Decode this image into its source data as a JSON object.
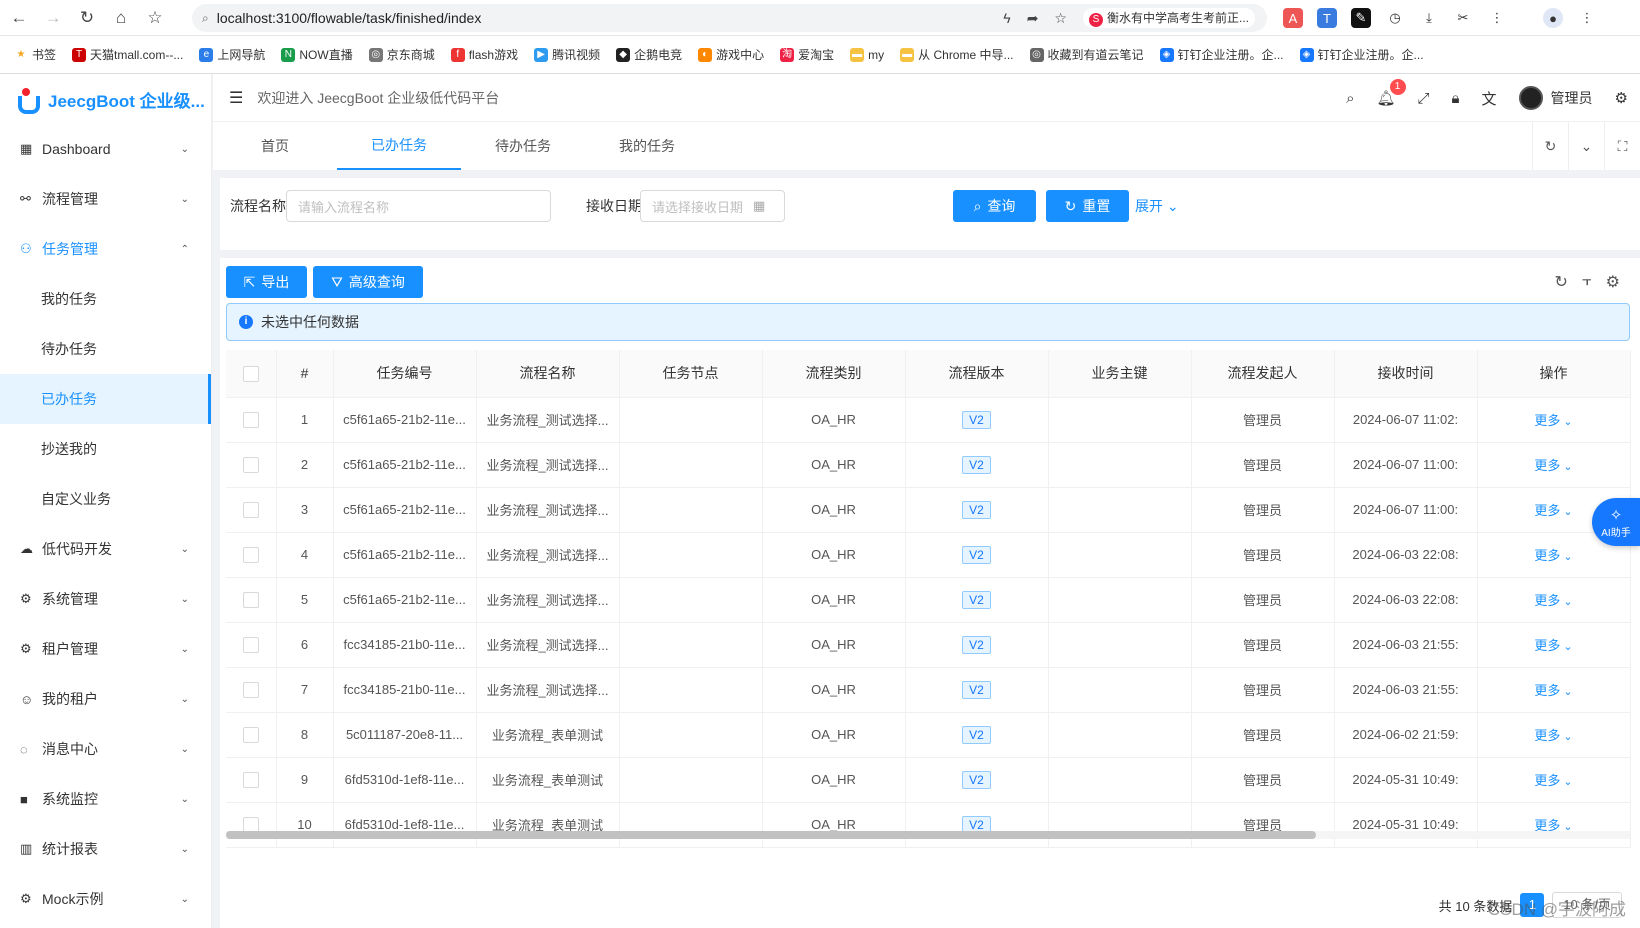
{
  "browser": {
    "url": "localhost:3100/flowable/task/finished/index",
    "ext_tag": "衡水有中学高考生考前正...",
    "bookmarks": [
      "书签",
      "天猫tmall.com--...",
      "上网导航",
      "NOW直播",
      "京东商城",
      "flash游戏",
      "腾讯视频",
      "企鹅电竞",
      "游戏中心",
      "爱淘宝",
      "my",
      "从 Chrome 中导...",
      "收藏到有道云笔记",
      "钉钉企业注册。企...",
      "钉钉企业注册。企..."
    ]
  },
  "app": {
    "logo_text": "JeecgBoot 企业级...",
    "welcome": "欢迎进入 JeecgBoot 企业级低代码平台",
    "user_name": "管理员",
    "notify_count": "1"
  },
  "sidebar": {
    "items": [
      {
        "label": "Dashboard",
        "icon": "dashboard-icon"
      },
      {
        "label": "流程管理",
        "icon": "flow-icon"
      },
      {
        "label": "任务管理",
        "icon": "task-icon"
      },
      {
        "label": "低代码开发",
        "icon": "cloud-icon"
      },
      {
        "label": "系统管理",
        "icon": "gear-icon"
      },
      {
        "label": "租户管理",
        "icon": "gear-icon"
      },
      {
        "label": "我的租户",
        "icon": "user-icon"
      },
      {
        "label": "消息中心",
        "icon": "message-icon"
      },
      {
        "label": "系统监控",
        "icon": "monitor-icon"
      },
      {
        "label": "统计报表",
        "icon": "chart-icon"
      },
      {
        "label": "Mock示例",
        "icon": "gear-icon"
      }
    ],
    "sub_items": [
      "我的任务",
      "待办任务",
      "已办任务",
      "抄送我的",
      "自定义业务"
    ]
  },
  "tabs": [
    "首页",
    "已办任务",
    "待办任务",
    "我的任务"
  ],
  "search": {
    "name_label": "流程名称",
    "name_placeholder": "请输入流程名称",
    "date_label": "接收日期",
    "date_placeholder": "请选择接收日期",
    "query_btn": "查询",
    "reset_btn": "重置",
    "expand": "展开"
  },
  "toolbar": {
    "export_btn": "导出",
    "advanced_btn": "高级查询",
    "alert": "未选中任何数据"
  },
  "table": {
    "headers": [
      "#",
      "任务编号",
      "流程名称",
      "任务节点",
      "流程类别",
      "流程版本",
      "业务主键",
      "流程发起人",
      "接收时间",
      "操作"
    ],
    "rows": [
      {
        "idx": "1",
        "id": "c5f61a65-21b2-11e...",
        "name": "业务流程_测试选择...",
        "node": "",
        "cat": "OA_HR",
        "ver": "V2",
        "key": "",
        "starter": "管理员",
        "time": "2024-06-07 11:02:",
        "op": "更多"
      },
      {
        "idx": "2",
        "id": "c5f61a65-21b2-11e...",
        "name": "业务流程_测试选择...",
        "node": "",
        "cat": "OA_HR",
        "ver": "V2",
        "key": "",
        "starter": "管理员",
        "time": "2024-06-07 11:00:",
        "op": "更多"
      },
      {
        "idx": "3",
        "id": "c5f61a65-21b2-11e...",
        "name": "业务流程_测试选择...",
        "node": "",
        "cat": "OA_HR",
        "ver": "V2",
        "key": "",
        "starter": "管理员",
        "time": "2024-06-07 11:00:",
        "op": "更多"
      },
      {
        "idx": "4",
        "id": "c5f61a65-21b2-11e...",
        "name": "业务流程_测试选择...",
        "node": "",
        "cat": "OA_HR",
        "ver": "V2",
        "key": "",
        "starter": "管理员",
        "time": "2024-06-03 22:08:",
        "op": "更多"
      },
      {
        "idx": "5",
        "id": "c5f61a65-21b2-11e...",
        "name": "业务流程_测试选择...",
        "node": "",
        "cat": "OA_HR",
        "ver": "V2",
        "key": "",
        "starter": "管理员",
        "time": "2024-06-03 22:08:",
        "op": "更多"
      },
      {
        "idx": "6",
        "id": "fcc34185-21b0-11e...",
        "name": "业务流程_测试选择...",
        "node": "",
        "cat": "OA_HR",
        "ver": "V2",
        "key": "",
        "starter": "管理员",
        "time": "2024-06-03 21:55:",
        "op": "更多"
      },
      {
        "idx": "7",
        "id": "fcc34185-21b0-11e...",
        "name": "业务流程_测试选择...",
        "node": "",
        "cat": "OA_HR",
        "ver": "V2",
        "key": "",
        "starter": "管理员",
        "time": "2024-06-03 21:55:",
        "op": "更多"
      },
      {
        "idx": "8",
        "id": "5c011187-20e8-11...",
        "name": "业务流程_表单测试",
        "node": "",
        "cat": "OA_HR",
        "ver": "V2",
        "key": "",
        "starter": "管理员",
        "time": "2024-06-02 21:59:",
        "op": "更多"
      },
      {
        "idx": "9",
        "id": "6fd5310d-1ef8-11e...",
        "name": "业务流程_表单测试",
        "node": "",
        "cat": "OA_HR",
        "ver": "V2",
        "key": "",
        "starter": "管理员",
        "time": "2024-05-31 10:49:",
        "op": "更多"
      },
      {
        "idx": "10",
        "id": "6fd5310d-1ef8-11e...",
        "name": "业务流程_表单测试",
        "node": "",
        "cat": "OA_HR",
        "ver": "V2",
        "key": "",
        "starter": "管理员",
        "time": "2024-05-31 10:49:",
        "op": "更多"
      }
    ]
  },
  "pager": {
    "total": "共 10 条数据",
    "current": "1",
    "size": "10 条/页"
  },
  "ai_helper": "AI助手",
  "watermark": "CSDN @宇波阿成",
  "colors": {
    "primary": "#1890ff",
    "alert_bg": "#e6f4ff"
  }
}
